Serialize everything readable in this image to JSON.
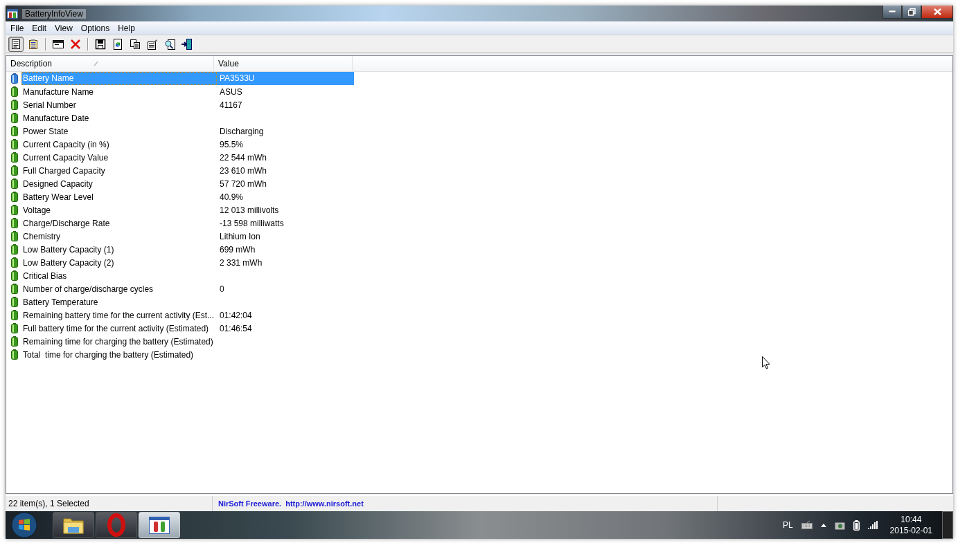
{
  "window": {
    "title": "BatteryInfoView"
  },
  "menu": [
    "File",
    "Edit",
    "View",
    "Options",
    "Help"
  ],
  "toolbar": [
    {
      "pressed": true
    },
    {
      "pressed": false
    },
    {
      "pressed": false
    },
    {
      "pressed": false
    },
    {
      "pressed": false
    },
    {
      "pressed": false
    },
    {
      "pressed": false
    },
    {
      "pressed": false
    },
    {
      "pressed": false
    },
    {
      "pressed": false
    }
  ],
  "table": {
    "columns": [
      {
        "label": "Description",
        "sorted": true
      },
      {
        "label": "Value",
        "sorted": false
      }
    ],
    "rows": [
      {
        "description": "Battery Name",
        "value": "PA3533U",
        "selected": true
      },
      {
        "description": "Manufacture Name",
        "value": "ASUS",
        "selected": false
      },
      {
        "description": "Serial Number",
        "value": "41167",
        "selected": false
      },
      {
        "description": "Manufacture Date",
        "selected": false
      },
      {
        "description": "Power State",
        "value": "Discharging",
        "selected": false
      },
      {
        "description": "Current Capacity (in %)",
        "value": "95.5%",
        "selected": false
      },
      {
        "description": "Current Capacity Value",
        "value": "22 544 mWh",
        "selected": false
      },
      {
        "description": "Full Charged Capacity",
        "value": "23 610 mWh",
        "selected": false
      },
      {
        "description": "Designed Capacity",
        "value": "57 720 mWh",
        "selected": false
      },
      {
        "description": "Battery Wear Level",
        "value": "40.9%",
        "selected": false
      },
      {
        "description": "Voltage",
        "value": "12 013 millivolts",
        "selected": false
      },
      {
        "description": "Charge/Discharge Rate",
        "value": "-13 598 milliwatts",
        "selected": false
      },
      {
        "description": "Chemistry",
        "value": "Lithium Ion",
        "selected": false
      },
      {
        "description": "Low Battery Capacity (1)",
        "value": "699 mWh",
        "selected": false
      },
      {
        "description": "Low Battery Capacity (2)",
        "value": "2 331 mWh",
        "selected": false
      },
      {
        "description": "Critical Bias",
        "selected": false
      },
      {
        "description": "Number of charge/discharge cycles",
        "value": "0",
        "selected": false
      },
      {
        "description": "Battery Temperature",
        "selected": false
      },
      {
        "description": "Remaining battery time for the current activity (Est...",
        "value": "01:42:04",
        "selected": false
      },
      {
        "description": "Full battery time for the current activity (Estimated)",
        "value": "01:46:54",
        "selected": false
      },
      {
        "description": "Remaining time for charging the battery (Estimated)",
        "selected": false
      },
      {
        "description": "Total  time for charging the battery (Estimated)",
        "selected": false
      }
    ]
  },
  "status_bar": {
    "count": "22 item(s), 1 Selected",
    "credit": "NirSoft Freeware.  http://www.nirsoft.net"
  },
  "taskbar": {
    "apps": [
      {
        "selected": false
      },
      {
        "selected": false
      },
      {
        "selected": true
      }
    ],
    "language": "PL",
    "time": "10:44",
    "date": "2015-02-01"
  }
}
